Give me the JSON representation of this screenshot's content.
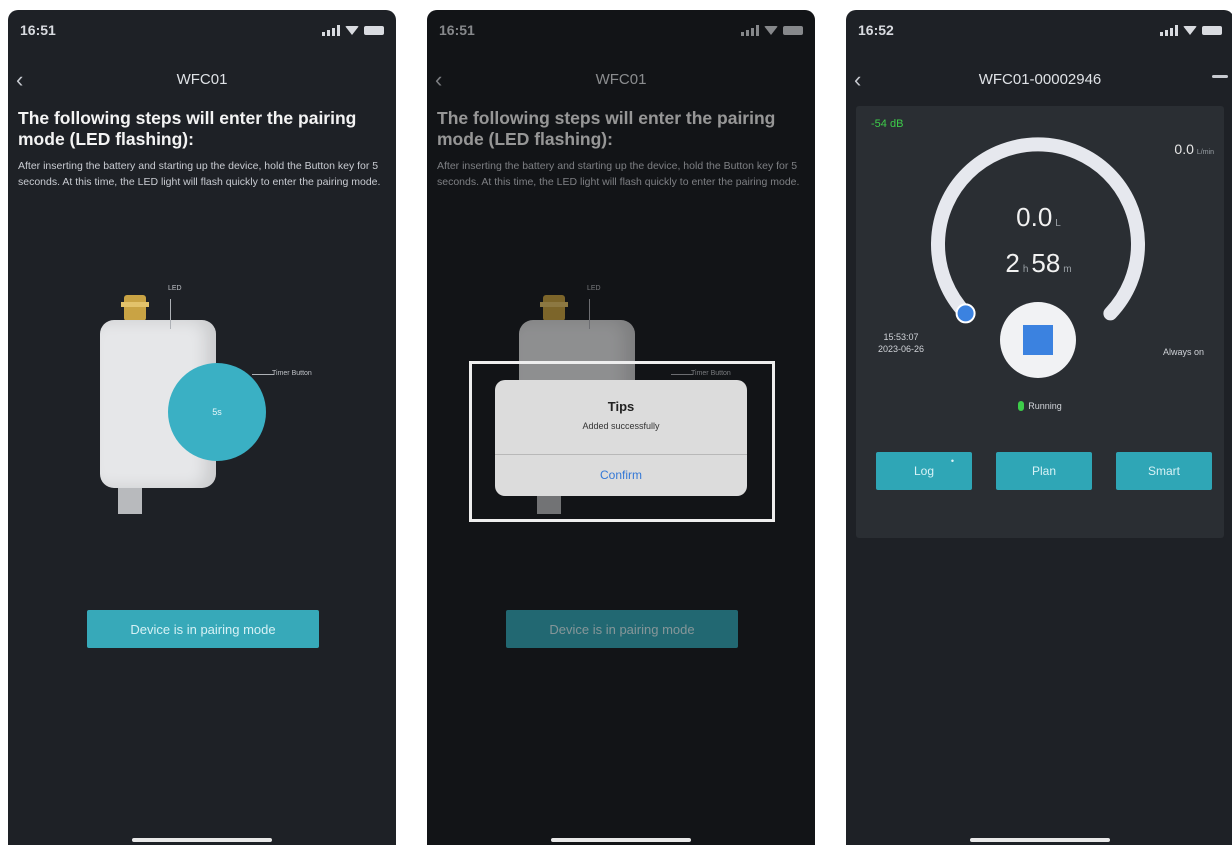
{
  "screen1": {
    "time": "16:51",
    "nav_title": "WFC01",
    "heading": "The following steps will enter the pairing mode (LED flashing):",
    "description": "After inserting the battery and starting up the device, hold the Button key for 5 seconds. At this time, the LED light will flash quickly to enter the pairing mode.",
    "led_label": "LED",
    "timer_label": "Timer Button",
    "button_text": "5s",
    "pair_button": "Device is in pairing mode"
  },
  "screen2": {
    "time": "16:51",
    "nav_title": "WFC01",
    "heading": "The following steps will enter the pairing mode (LED flashing):",
    "description": "After inserting the battery and starting up the device, hold the Button key for 5 seconds. At this time, the LED light will flash quickly to enter the pairing mode.",
    "led_label": "LED",
    "timer_label": "Timer Button",
    "pair_button": "Device is in pairing mode",
    "dialog": {
      "title": "Tips",
      "message": "Added successfully",
      "confirm": "Confirm"
    }
  },
  "screen3": {
    "time": "16:52",
    "nav_title": "WFC01-00002946",
    "signal": "-54 dB",
    "flow_value": "0.0",
    "flow_unit": "L/min",
    "volume_value": "0.0",
    "volume_unit": "L",
    "duration_hours": "2",
    "duration_hours_unit": "h",
    "duration_minutes": "58",
    "duration_minutes_unit": "m",
    "start_time": "15:53:07",
    "start_date": "2023-06-26",
    "mode_label": "Always on",
    "status_label": "Running",
    "tabs": [
      "Log",
      "Plan",
      "Smart"
    ],
    "accent": "#3ab0c4"
  }
}
